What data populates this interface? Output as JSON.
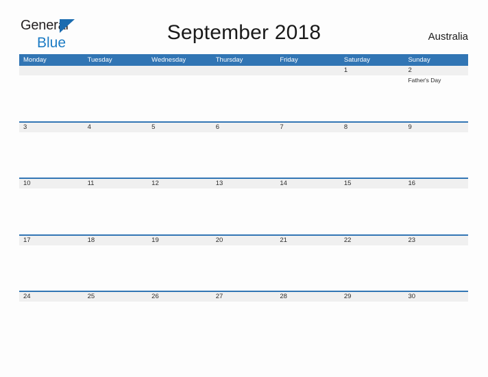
{
  "logo": {
    "text_primary": "General",
    "text_secondary": "Blue",
    "triangle_color": "#1B6CB0",
    "primary_color": "#231F20",
    "secondary_color": "#1B7BC4"
  },
  "header": {
    "title": "September 2018",
    "country": "Australia"
  },
  "theme": {
    "header_blue": "#3175B4",
    "band_gray": "#F0F0F0",
    "page_background": "#FDFDFD",
    "text_color": "#2B2B2B"
  },
  "calendar": {
    "month": "September",
    "year": "2018",
    "week_start": "Monday",
    "weekdays": [
      "Monday",
      "Tuesday",
      "Wednesday",
      "Thursday",
      "Friday",
      "Saturday",
      "Sunday"
    ],
    "weeks": [
      {
        "days": [
          {
            "number": "",
            "event": ""
          },
          {
            "number": "",
            "event": ""
          },
          {
            "number": "",
            "event": ""
          },
          {
            "number": "",
            "event": ""
          },
          {
            "number": "",
            "event": ""
          },
          {
            "number": "1",
            "event": ""
          },
          {
            "number": "2",
            "event": "Father's Day"
          }
        ]
      },
      {
        "days": [
          {
            "number": "3",
            "event": ""
          },
          {
            "number": "4",
            "event": ""
          },
          {
            "number": "5",
            "event": ""
          },
          {
            "number": "6",
            "event": ""
          },
          {
            "number": "7",
            "event": ""
          },
          {
            "number": "8",
            "event": ""
          },
          {
            "number": "9",
            "event": ""
          }
        ]
      },
      {
        "days": [
          {
            "number": "10",
            "event": ""
          },
          {
            "number": "11",
            "event": ""
          },
          {
            "number": "12",
            "event": ""
          },
          {
            "number": "13",
            "event": ""
          },
          {
            "number": "14",
            "event": ""
          },
          {
            "number": "15",
            "event": ""
          },
          {
            "number": "16",
            "event": ""
          }
        ]
      },
      {
        "days": [
          {
            "number": "17",
            "event": ""
          },
          {
            "number": "18",
            "event": ""
          },
          {
            "number": "19",
            "event": ""
          },
          {
            "number": "20",
            "event": ""
          },
          {
            "number": "21",
            "event": ""
          },
          {
            "number": "22",
            "event": ""
          },
          {
            "number": "23",
            "event": ""
          }
        ]
      },
      {
        "days": [
          {
            "number": "24",
            "event": ""
          },
          {
            "number": "25",
            "event": ""
          },
          {
            "number": "26",
            "event": ""
          },
          {
            "number": "27",
            "event": ""
          },
          {
            "number": "28",
            "event": ""
          },
          {
            "number": "29",
            "event": ""
          },
          {
            "number": "30",
            "event": ""
          }
        ]
      }
    ]
  }
}
